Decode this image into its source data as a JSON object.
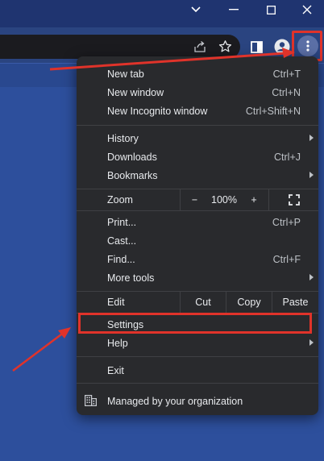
{
  "window": {
    "minimize_glyph": "—",
    "maximize_glyph": "☐",
    "close_glyph": "✕",
    "dropdown_glyph": "⌄"
  },
  "toolbar": {
    "share_icon": "share-icon",
    "bookmark_icon": "star-icon",
    "sidepanel_icon": "side-panel-icon",
    "profile_icon": "profile-icon",
    "menu_icon": "three-dots-icon"
  },
  "menu": {
    "group1": [
      {
        "label": "New tab",
        "shortcut": "Ctrl+T"
      },
      {
        "label": "New window",
        "shortcut": "Ctrl+N"
      },
      {
        "label": "New Incognito window",
        "shortcut": "Ctrl+Shift+N"
      }
    ],
    "group2": [
      {
        "label": "History",
        "shortcut": ""
      },
      {
        "label": "Downloads",
        "shortcut": "Ctrl+J"
      },
      {
        "label": "Bookmarks",
        "shortcut": ""
      }
    ],
    "zoom": {
      "label": "Zoom",
      "minus": "−",
      "value": "100%",
      "plus": "+",
      "fullscreen_icon": "fullscreen-icon"
    },
    "group3": [
      {
        "label": "Print...",
        "shortcut": "Ctrl+P"
      },
      {
        "label": "Cast...",
        "shortcut": ""
      },
      {
        "label": "Find...",
        "shortcut": "Ctrl+F"
      },
      {
        "label": "More tools",
        "shortcut": ""
      }
    ],
    "edit": {
      "label": "Edit",
      "cut": "Cut",
      "copy": "Copy",
      "paste": "Paste"
    },
    "settings": "Settings",
    "help": "Help",
    "exit": "Exit",
    "managed": "Managed by your organization"
  },
  "colors": {
    "annotation": "#e0332a",
    "menu_bg": "#292a2d",
    "page_bg": "#2d4f9c"
  }
}
